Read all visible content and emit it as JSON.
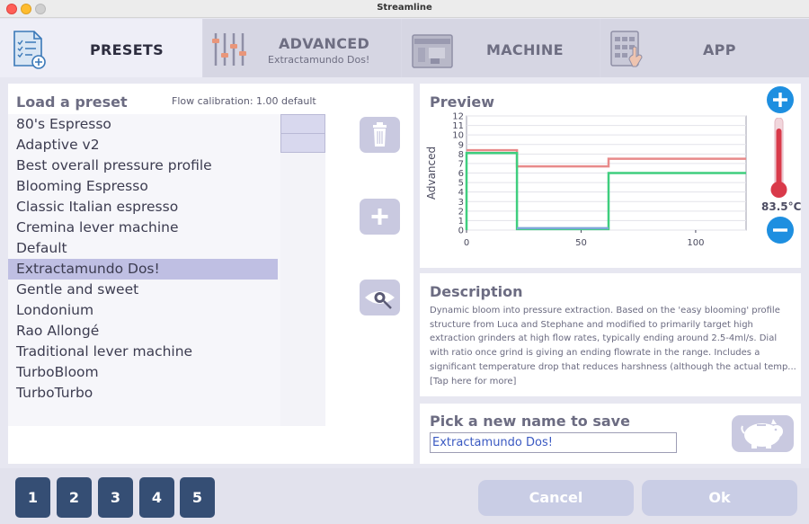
{
  "window": {
    "title": "Streamline"
  },
  "tabs": {
    "presets": {
      "label": "PRESETS"
    },
    "advanced": {
      "label": "ADVANCED",
      "sublabel": "Extractamundo Dos!"
    },
    "machine": {
      "label": "MACHINE"
    },
    "app": {
      "label": "APP"
    }
  },
  "presets": {
    "title": "Load a preset",
    "flow_calibration": "Flow calibration: 1.00",
    "flow_calibration_mode": "default",
    "items": [
      "80's Espresso",
      "Adaptive v2",
      "Best overall pressure profile",
      "Blooming Espresso",
      "Classic Italian espresso",
      "Cremina lever machine",
      "Default",
      "Extractamundo Dos!",
      "Gentle and sweet",
      "Londonium",
      "Rao Allongé",
      "Traditional lever machine",
      "TurboBloom",
      "TurboTurbo"
    ],
    "selected": "Extractamundo Dos!"
  },
  "preview": {
    "title": "Preview",
    "temperature": "83.5°C"
  },
  "description": {
    "title": "Description",
    "text": "Dynamic bloom into pressure extraction. Based on the 'easy blooming' profile structure from Luca and Stephane and modified to primarily target high extraction grinders at high flow rates, typically ending around 2.5-4ml/s. Dial with ratio once grind is giving an ending flowrate in the range. Includes a significant temperature drop that reduces harshness (although the actual temp... [Tap here for more]"
  },
  "save": {
    "title": "Pick a new name to save",
    "value": "Extractamundo Dos!"
  },
  "bottom": {
    "slots": [
      "1",
      "2",
      "3",
      "4",
      "5"
    ],
    "cancel_label": "Cancel",
    "ok_label": "Ok"
  },
  "colors": {
    "accent": "#1e8fe0",
    "slot_button": "#354e74",
    "selection": "#bfbfe3",
    "pressure_line": "#e88a8a",
    "flow_line": "#3fce7e",
    "thermo_red": "#d93a4a"
  },
  "chart_data": {
    "type": "line",
    "title": "",
    "xlabel": "",
    "ylabel": "Advanced",
    "xlim": [
      0,
      122
    ],
    "ylim": [
      0,
      12
    ],
    "x_ticks": [
      0,
      50,
      100
    ],
    "y_ticks": [
      0,
      1,
      2,
      3,
      4,
      5,
      6,
      7,
      8,
      9,
      10,
      11,
      12
    ],
    "grid": true,
    "series": [
      {
        "color": "#e88a8a",
        "points": [
          [
            0,
            8.4
          ],
          [
            22,
            8.4
          ],
          [
            22,
            6.7
          ],
          [
            62,
            6.7
          ],
          [
            62,
            7.5
          ],
          [
            122,
            7.5
          ]
        ]
      },
      {
        "color": "#3fce7e",
        "points": [
          [
            0,
            0
          ],
          [
            0,
            8.1
          ],
          [
            22,
            8.1
          ],
          [
            22,
            0.1
          ],
          [
            62,
            0.1
          ],
          [
            62,
            6.0
          ],
          [
            122,
            6.0
          ]
        ]
      },
      {
        "color": "#7ea6d8",
        "points": [
          [
            22,
            0.2
          ],
          [
            62,
            0.2
          ]
        ]
      }
    ]
  }
}
